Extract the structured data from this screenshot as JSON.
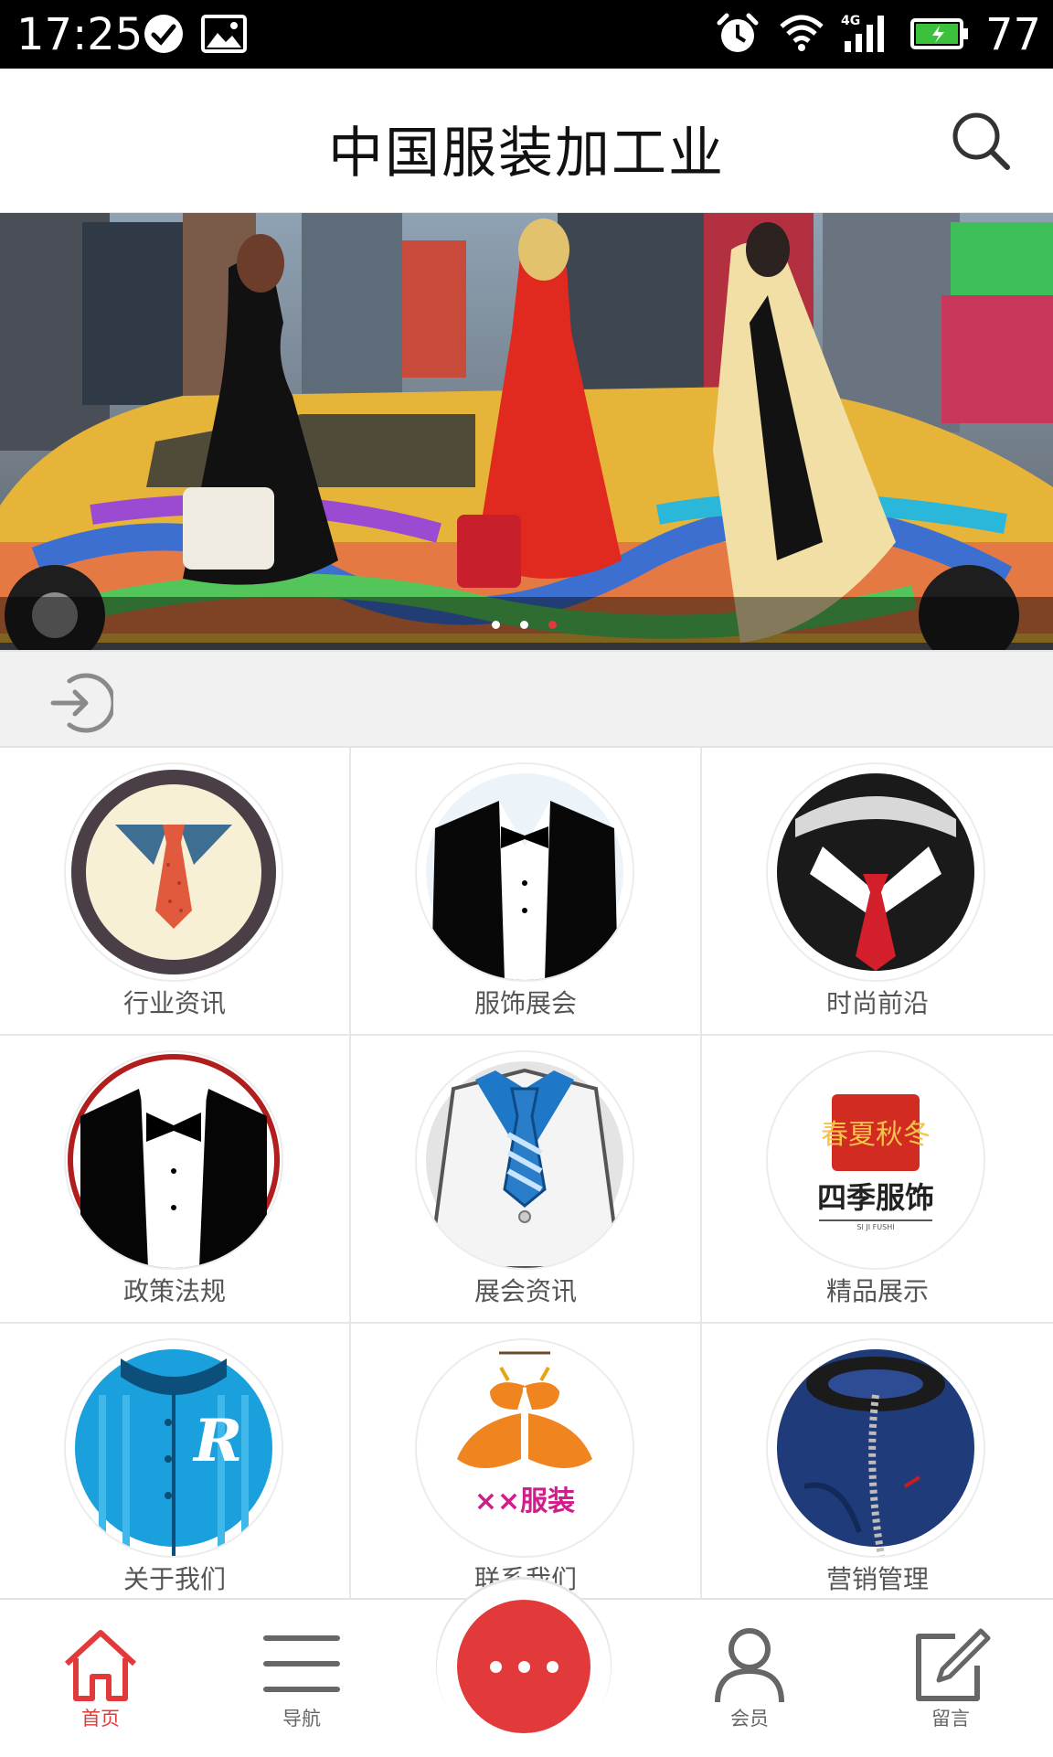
{
  "status_bar": {
    "time": "17:25",
    "battery_level": "77",
    "icons": [
      "check-circle-icon",
      "image-icon",
      "alarm-icon",
      "wifi-icon",
      "4g-signal-icon",
      "battery-charging-icon"
    ]
  },
  "header": {
    "title": "中国服装加工业",
    "search_icon": "search-icon"
  },
  "banner": {
    "dots_count": 3,
    "active_dot": 3
  },
  "login": {
    "icon": "login-icon"
  },
  "grid": {
    "items": [
      {
        "label": "行业资讯",
        "icon": "tie-icon"
      },
      {
        "label": "服饰展会",
        "icon": "tuxedo-icon"
      },
      {
        "label": "时尚前沿",
        "icon": "suit-red-tie-icon"
      },
      {
        "label": "政策法规",
        "icon": "bowtie-tuxedo-icon"
      },
      {
        "label": "展会资讯",
        "icon": "white-suit-icon"
      },
      {
        "label": "精品展示",
        "icon": "four-seasons-logo-icon"
      },
      {
        "label": "关于我们",
        "icon": "jersey-icon"
      },
      {
        "label": "联系我们",
        "icon": "butterfly-logo-icon"
      },
      {
        "label": "营销管理",
        "icon": "jacket-zipper-icon"
      }
    ],
    "logo_text": {
      "seal": "春夏秋冬",
      "brand": "四季服饰",
      "brand_sub": "SI JI FUSHI",
      "butterfly": "××服装"
    }
  },
  "bottom_nav": {
    "items": [
      {
        "label": "首页",
        "icon": "home-icon",
        "active": true
      },
      {
        "label": "导航",
        "icon": "menu-icon",
        "active": false
      },
      {
        "label": "会员",
        "icon": "user-icon",
        "active": false
      },
      {
        "label": "留言",
        "icon": "edit-icon",
        "active": false
      }
    ],
    "center_icon": "more-icon"
  },
  "colors": {
    "accent": "#e23a3a",
    "status_bar": "#000000",
    "strip": "#f1f1f1"
  }
}
